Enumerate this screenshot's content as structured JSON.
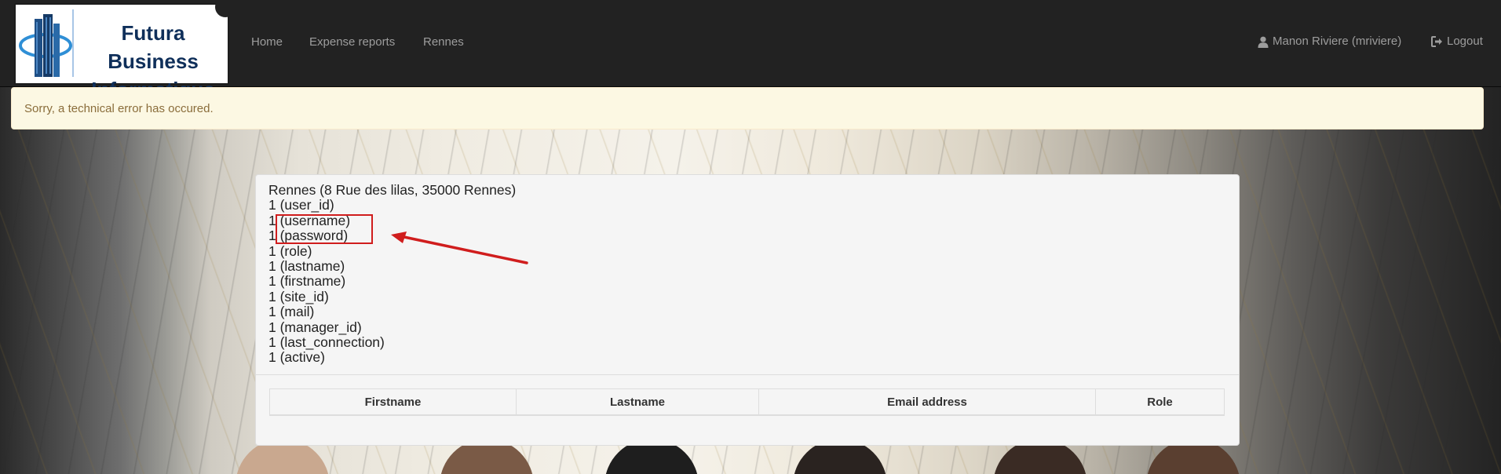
{
  "navbar": {
    "brand": {
      "line1": "Futura Business",
      "line2": "Informatique"
    },
    "links": [
      {
        "label": "Home"
      },
      {
        "label": "Expense reports"
      },
      {
        "label": "Rennes"
      }
    ],
    "user": {
      "label": "Manon Riviere (mriviere)",
      "icon": "user-icon"
    },
    "logout": {
      "label": "Logout",
      "icon": "logout-icon"
    },
    "background_color": "#222222",
    "link_color": "#9d9d9d"
  },
  "alert": {
    "message": "Sorry, a technical error has occured.",
    "background_color": "#fcf8e3",
    "text_color": "#8a6d3b"
  },
  "panel": {
    "lines": [
      "Rennes (8 Rue des lilas, 35000 Rennes)",
      "1 (user_id)",
      "1 (username)",
      "1 (password)",
      "1 (role)",
      "1 (lastname)",
      "1 (firstname)",
      "1 (site_id)",
      "1 (mail)",
      "1 (manager_id)",
      "1 (last_connection)",
      "1 (active)"
    ],
    "annotation": {
      "color": "#d01d1d",
      "shape": "red rectangle with arrow"
    }
  },
  "table": {
    "headers": [
      "Firstname",
      "Lastname",
      "Email address",
      "Role"
    ]
  }
}
